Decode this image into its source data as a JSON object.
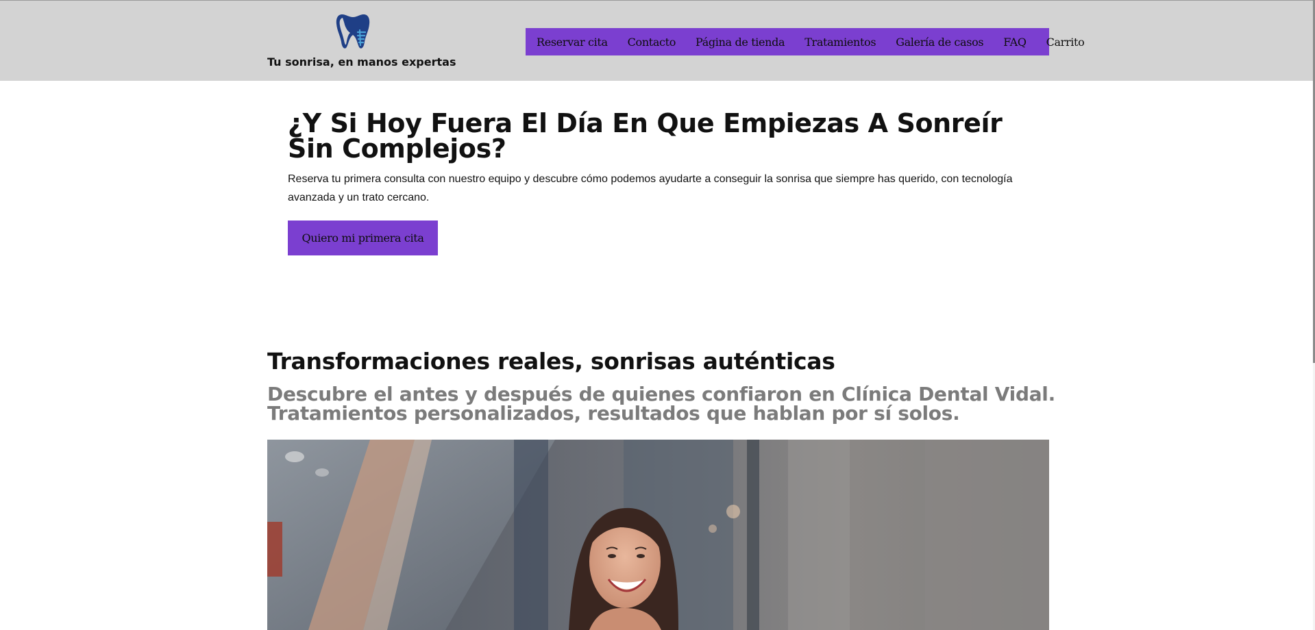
{
  "header": {
    "logo_icon": "tooth-logo-icon",
    "tagline": "Tu sonrisa, en manos expertas",
    "background_color": "#d3d3d3"
  },
  "nav": {
    "background_color": "#7b3fd0",
    "items": [
      {
        "label": "Reservar cita"
      },
      {
        "label": "Contacto"
      },
      {
        "label": "Página de tienda"
      },
      {
        "label": "Tratamientos"
      },
      {
        "label": "Galería de casos"
      },
      {
        "label": "FAQ"
      },
      {
        "label": "Carrito"
      }
    ]
  },
  "hero": {
    "title": "¿Y Si Hoy Fuera El Día En Que Empiezas A Sonreír Sin Complejos?",
    "text": "Reserva tu primera consulta con nuestro equipo y descubre cómo podemos ayudarte a conseguir la sonrisa que siempre has querido, con tecnología avanzada y un trato cercano.",
    "button_label": "Quiero mi primera cita"
  },
  "gallery": {
    "title": "Transformaciones reales, sonrisas auténticas",
    "subtitle": "Descubre el antes y después de quienes confiaron en Clínica Dental Vidal. Tratamientos personalizados, resultados que hablan por sí solos.",
    "image": "smiling-woman-photo"
  },
  "colors": {
    "accent": "#7b3fd0",
    "subtitle_gray": "#7b7b7b",
    "logo_blue": "#2a5aa8"
  }
}
